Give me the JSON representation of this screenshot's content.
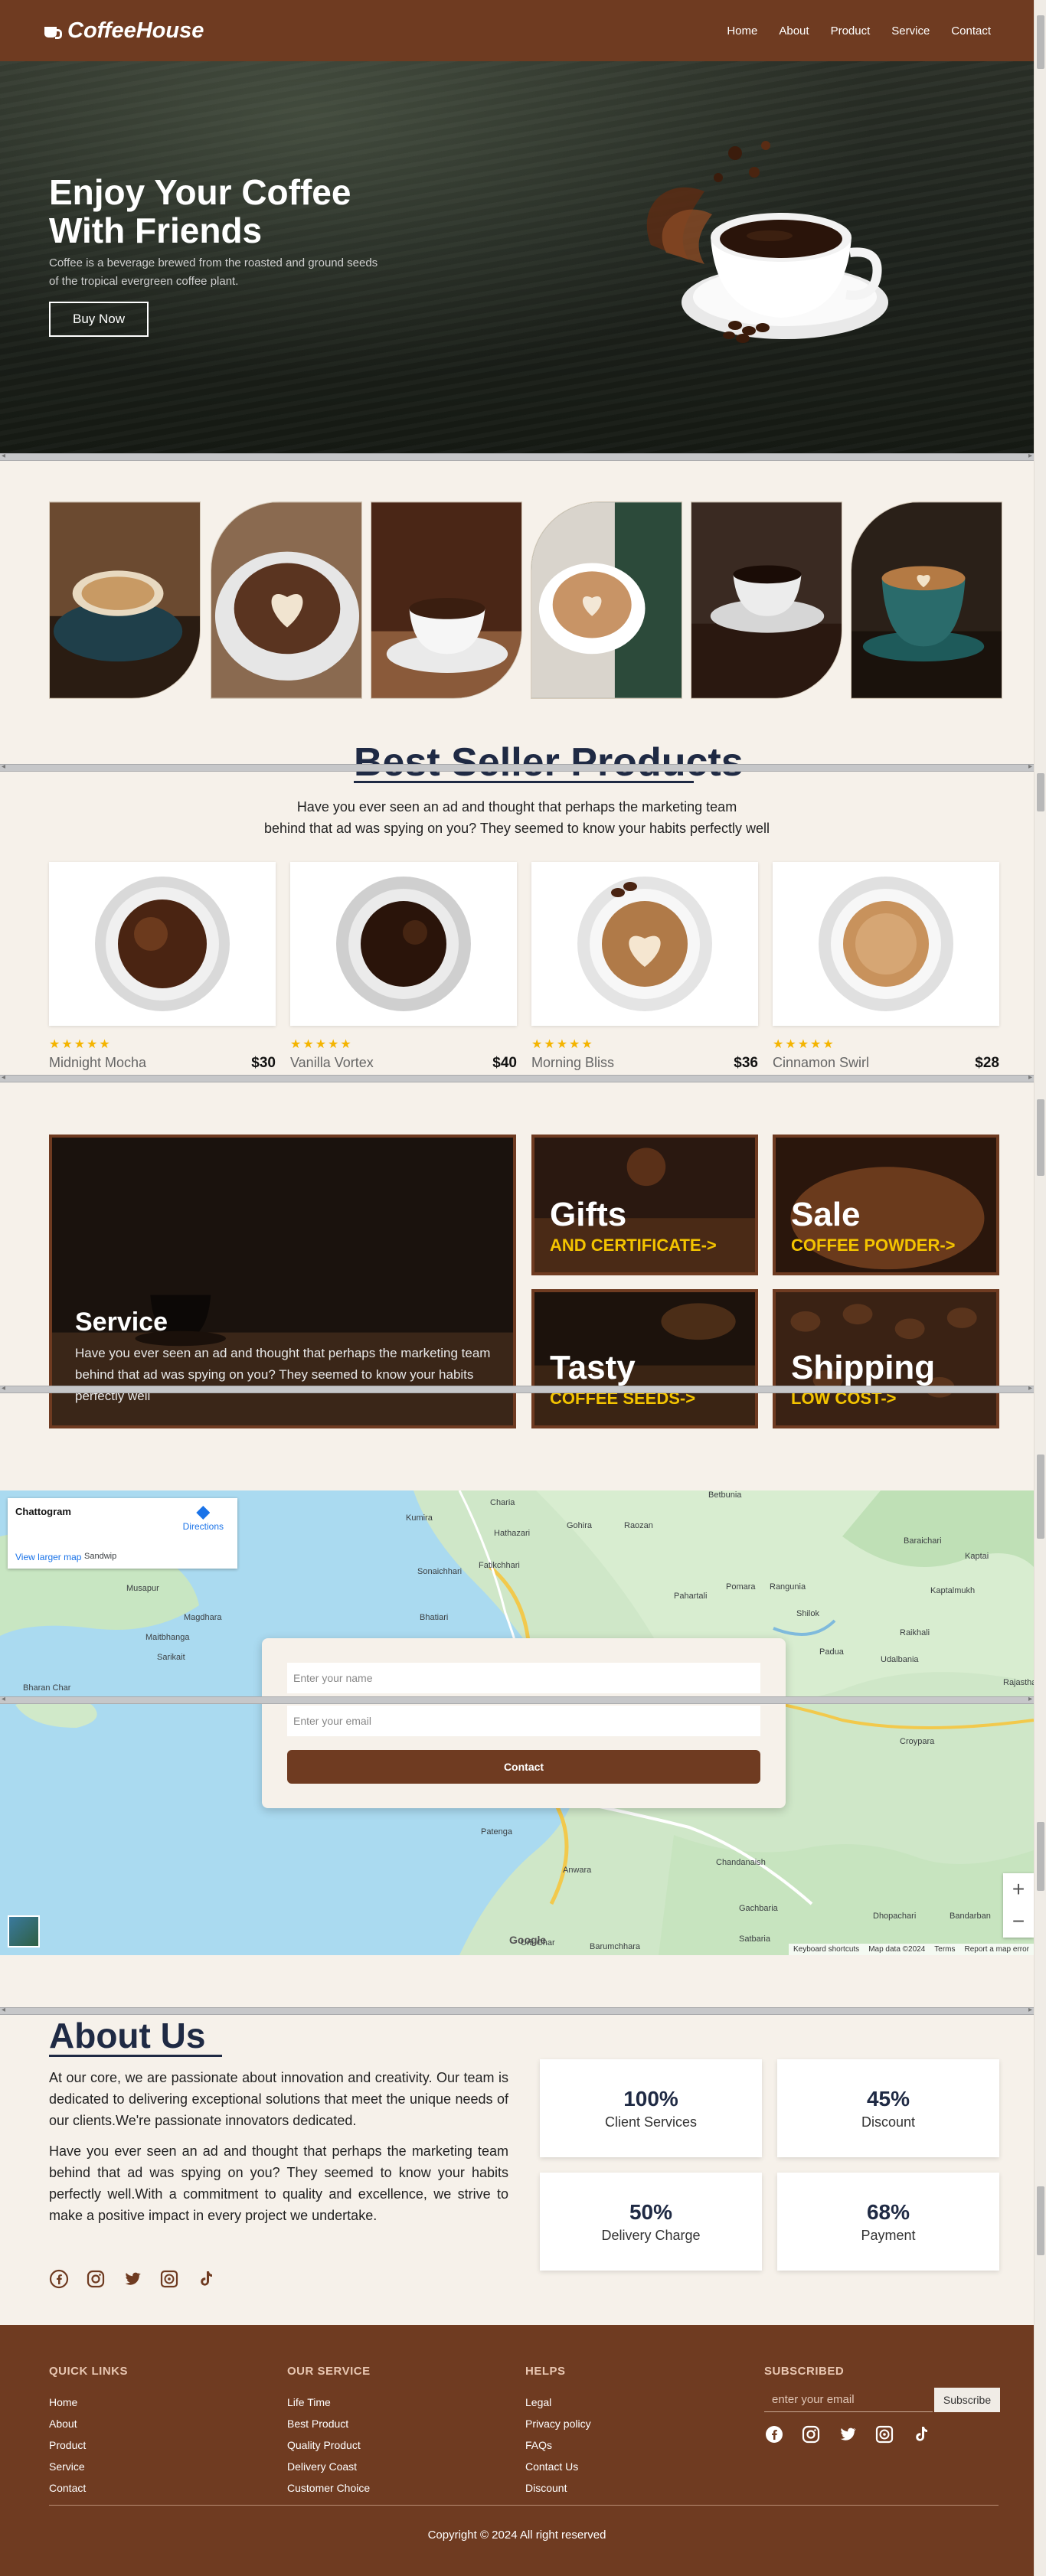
{
  "header": {
    "brand": "CoffeeHouse",
    "nav": [
      "Home",
      "About",
      "Product",
      "Service",
      "Contact"
    ]
  },
  "hero": {
    "title_line1": "Enjoy Your Coffee",
    "title_line2": "With Friends",
    "text": "Coffee is a beverage brewed from the roasted and ground seeds of the tropical evergreen coffee plant.",
    "button": "Buy Now"
  },
  "best_seller": {
    "title": "Best Seller Products",
    "subtitle_line1": "Have you ever seen an ad and thought that perhaps the marketing team",
    "subtitle_line2": "behind that ad was spying on you? They seemed to know your habits perfectly well",
    "stars": "★★★★★",
    "products": [
      {
        "name": "Midnight Mocha",
        "price": "$30"
      },
      {
        "name": "Vanilla Vortex",
        "price": "$40"
      },
      {
        "name": "Morning Bliss",
        "price": "$36"
      },
      {
        "name": "Cinnamon Swirl",
        "price": "$28"
      }
    ]
  },
  "promos": {
    "service_title": "Service",
    "service_desc": "Have you ever seen an ad and thought that perhaps the marketing team behind that ad was spying on you? They seemed to know your habits perfectly well",
    "tiles": [
      {
        "title": "Gifts",
        "sub": "AND CERTIFICATE->"
      },
      {
        "title": "Sale",
        "sub": "COFFEE POWDER->"
      },
      {
        "title": "Tasty",
        "sub": "COFFEE SEEDS->"
      },
      {
        "title": "Shipping",
        "sub": "LOW COST->"
      }
    ]
  },
  "map": {
    "place": "Chattogram",
    "directions": "Directions",
    "larger_map": "View larger map",
    "name_placeholder": "Enter your name",
    "email_placeholder": "Enter your email",
    "contact_button": "Contact",
    "zoom_in": "+",
    "zoom_out": "−",
    "google": "Google",
    "footer_items": [
      "Keyboard shortcuts",
      "Map data ©2024",
      "Terms",
      "Report a map error"
    ],
    "labels": [
      "Kumira",
      "Charia",
      "Hathazari",
      "Gohira",
      "Raozan",
      "Betbunia",
      "Sonaichhari",
      "Fatikchhari",
      "Pahartali",
      "Pomara",
      "Rangunia",
      "Shilok",
      "Raikhali",
      "Kaptalmukh",
      "Sandwip",
      "Musapur",
      "Magdhara",
      "Maitbhanga",
      "Sarikait",
      "Bhatiari",
      "Patenga",
      "Anwara",
      "Chandanaish",
      "Gachbaria",
      "Dhopachari",
      "Bandarban",
      "Satbaria",
      "Barumchhara",
      "Kaptai",
      "Baraichari",
      "Udalbania",
      "Rajasthali",
      "Padua",
      "Croypara",
      "Bharan Char",
      "Urir Char"
    ]
  },
  "about": {
    "title": "About Us",
    "para1": "At our core, we are passionate about innovation and creativity. Our team is dedicated to delivering exceptional solutions that meet the unique needs of our clients.We're passionate innovators dedicated.",
    "para2": "Have you ever seen an ad and thought that perhaps the marketing team behind that ad was spying on you? They seemed to know your habits perfectly well.With a commitment to quality and excellence, we strive to make a positive impact in every project we undertake.",
    "stats": [
      {
        "value": "100%",
        "label": "Client Services"
      },
      {
        "value": "45%",
        "label": "Discount"
      },
      {
        "value": "50%",
        "label": "Delivery Charge"
      },
      {
        "value": "68%",
        "label": "Payment"
      }
    ]
  },
  "footer": {
    "cols": [
      {
        "head": "QUICK LINKS",
        "links": [
          "Home",
          "About",
          "Product",
          "Service",
          "Contact"
        ]
      },
      {
        "head": "OUR SERVICE",
        "links": [
          "Life Time",
          "Best Product",
          "Quality Product",
          "Delivery Coast",
          "Customer Choice"
        ]
      },
      {
        "head": "HELPS",
        "links": [
          "Legal",
          "Privacy policy",
          "FAQs",
          "Contact Us",
          "Discount"
        ]
      }
    ],
    "subscribe_head": "SUBSCRIBED",
    "email_placeholder": "enter your email",
    "subscribe_button": "Subscribe",
    "copyright": "Copyright © 2024 All right reserved"
  },
  "colors": {
    "brand": "#6f3b21",
    "background": "#f6f1ea",
    "accent": "#f4c400",
    "heading": "#1f2a44"
  }
}
